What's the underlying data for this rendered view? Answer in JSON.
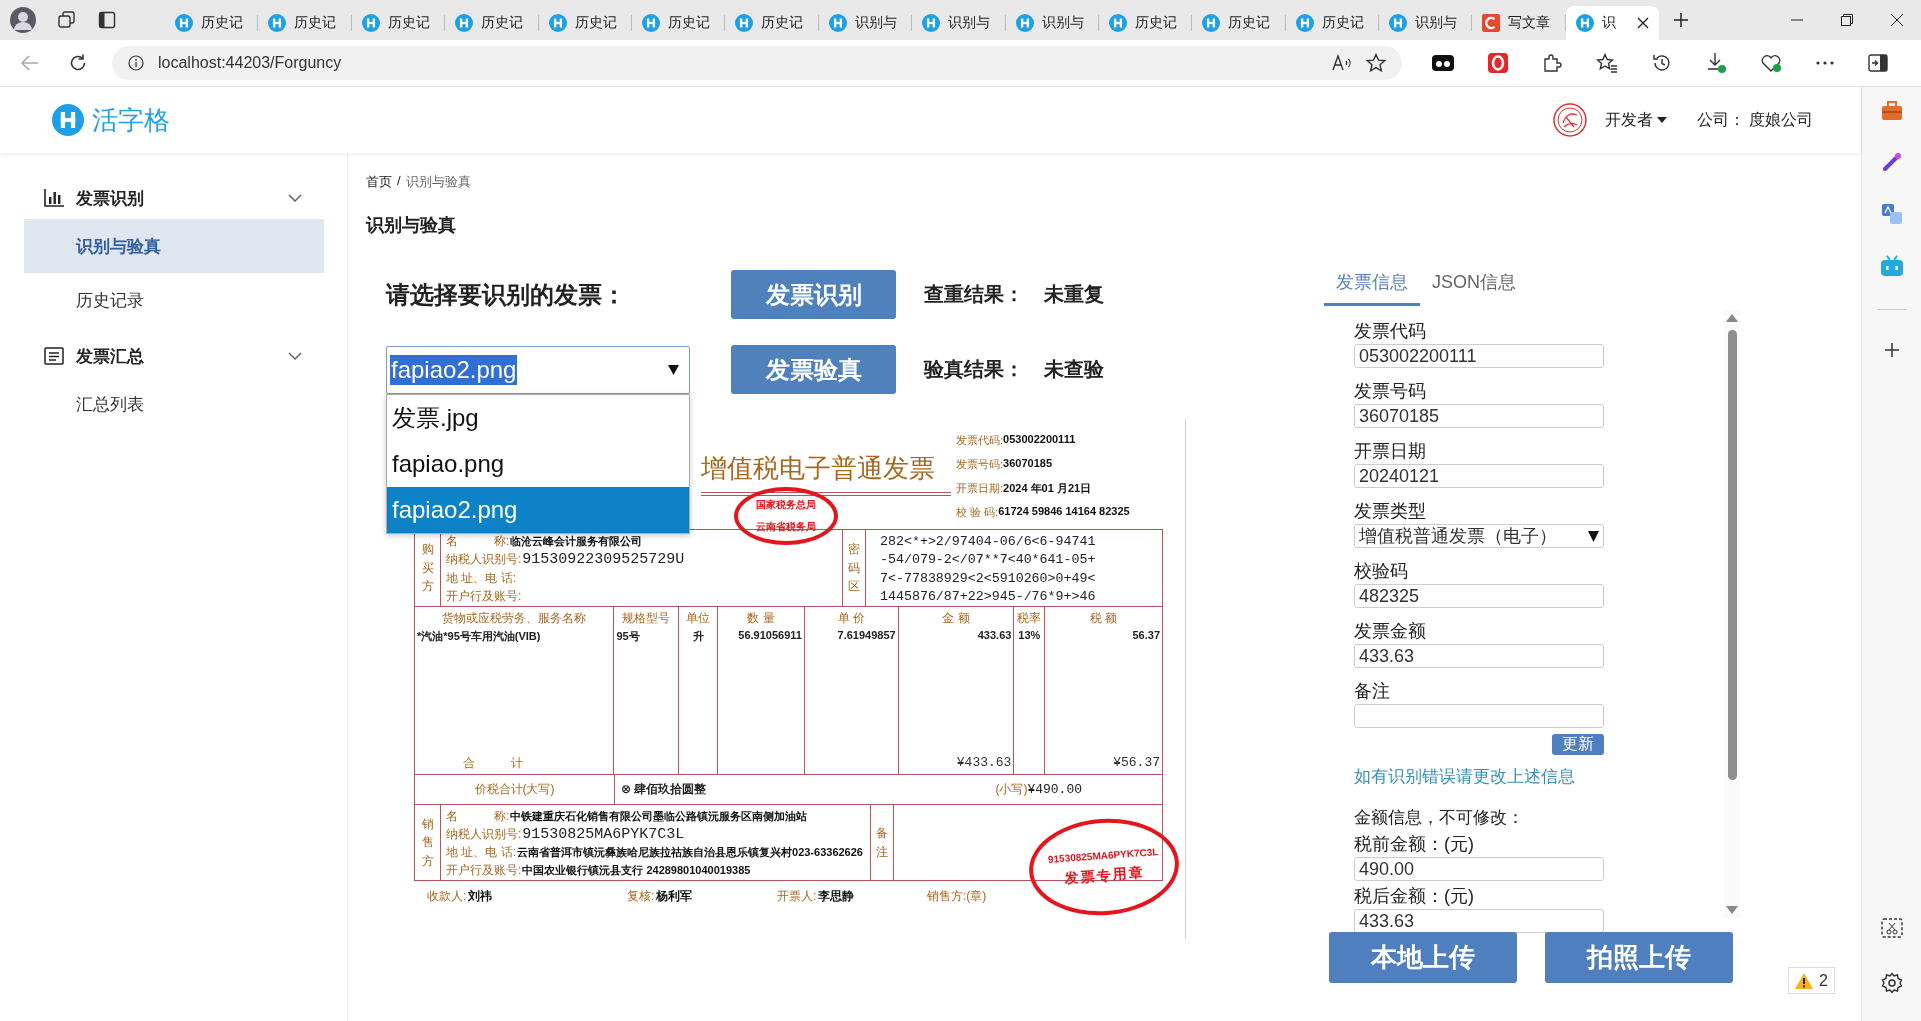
{
  "browser": {
    "tabs": [
      {
        "label": "历史记",
        "kind": "app",
        "selected": false
      },
      {
        "label": "历史记",
        "kind": "app",
        "selected": false
      },
      {
        "label": "历史记",
        "kind": "app",
        "selected": false
      },
      {
        "label": "历史记",
        "kind": "app",
        "selected": false
      },
      {
        "label": "历史记",
        "kind": "app",
        "selected": false
      },
      {
        "label": "历史记",
        "kind": "app",
        "selected": false
      },
      {
        "label": "历史记",
        "kind": "app",
        "selected": false
      },
      {
        "label": "识别与",
        "kind": "app",
        "selected": false
      },
      {
        "label": "识别与",
        "kind": "app",
        "selected": false
      },
      {
        "label": "识别与",
        "kind": "app",
        "selected": false
      },
      {
        "label": "历史记",
        "kind": "app",
        "selected": false
      },
      {
        "label": "历史记",
        "kind": "app",
        "selected": false
      },
      {
        "label": "历史记",
        "kind": "app",
        "selected": false
      },
      {
        "label": "识别与",
        "kind": "app",
        "selected": false
      },
      {
        "label": "写文章",
        "kind": "blog",
        "selected": false
      },
      {
        "label": "识",
        "kind": "app",
        "selected": true
      }
    ],
    "address": "localhost:44203/Forguncy"
  },
  "app_header": {
    "logo": "活字格",
    "user": "开发者",
    "company_label": "公司：",
    "company": "度娘公司"
  },
  "sidebar": {
    "items": [
      {
        "label": "发票识别",
        "kind": "chart",
        "expanded": true,
        "children": [
          {
            "label": "识别与验真",
            "selected": true
          },
          {
            "label": "历史记录",
            "selected": false
          }
        ]
      },
      {
        "label": "发票汇总",
        "kind": "list",
        "expanded": true,
        "children": [
          {
            "label": "汇总列表",
            "selected": false
          }
        ]
      }
    ]
  },
  "breadcrumb": {
    "items": [
      "首页",
      "识别与验真"
    ],
    "separator": "/"
  },
  "page_title": "识别与验真",
  "select_prompt": "请选择要识别的发票：",
  "file_select": {
    "value": "fapiao2.png",
    "expanded": true,
    "options": [
      {
        "label": "发票.jpg",
        "selected": false
      },
      {
        "label": "fapiao.png",
        "selected": false
      },
      {
        "label": "fapiao2.png",
        "selected": true
      }
    ]
  },
  "actions": [
    {
      "button": "发票识别",
      "result_label": "查重结果：",
      "result": "未重复"
    },
    {
      "button": "发票验真",
      "result_label": "验真结果：",
      "result": "未查验"
    }
  ],
  "invoice": {
    "title": "增值税电子普通发票",
    "seal_top": [
      "国家税务总局",
      "云南省税务局"
    ],
    "meta": [
      {
        "label": "发票代码:",
        "value": "053002200111"
      },
      {
        "label": "发票号码:",
        "value": "36070185"
      },
      {
        "label": "开票日期:",
        "value": "2024 年01 月21日"
      },
      {
        "label": "校 验 码:",
        "value": "61724 59846 14164 82325"
      }
    ],
    "buyer": {
      "side": "购买方",
      "fields": [
        {
          "label": "名　　　称:",
          "value": "临沧云峰会计服务有限公司"
        },
        {
          "label": "纳税人识别号:",
          "value": "91530922309525729U"
        },
        {
          "label": "地 址、电 话:"
        },
        {
          "label": "开户行及账号:"
        }
      ],
      "cipher_label": "密码区",
      "cipher": [
        "282<*+>2/97404-06/6<6-94741",
        "-54/079-2</07**7<40*641-05+",
        "7<-77838929<2<5910260>0+49<",
        "1445876/87+22>945-/76*9+>46"
      ]
    },
    "columns": [
      "货物或应税劳务、服务名称",
      "规格型号",
      "单位",
      "数 量",
      "单 价",
      "金 额",
      "税率",
      "税 额"
    ],
    "rows": [
      [
        "*汽油*95号车用汽油(VIB)",
        "95号",
        "升",
        "56.91056911",
        "7.61949857",
        "433.63",
        "13%",
        "56.37"
      ]
    ],
    "total": {
      "label": "合　　　计",
      "amount": "¥433.63",
      "tax": "¥56.37"
    },
    "grand": {
      "label": "价税合计(大写)",
      "words": "⊗ 肆佰玖拾圆整",
      "small_label": "(小写)",
      "small_value": "¥490.00"
    },
    "seller": {
      "side": "销售方",
      "fields": [
        {
          "label": "名　　　称:",
          "value": "中铁建重庆石化销售有限公司墨临公路镇沅服务区南侧加油站"
        },
        {
          "label": "纳税人识别号:",
          "value": "91530825MA6PYK7C3L"
        },
        {
          "label": "地 址、电 话:",
          "value": "云南省普洱市镇沅彝族哈尼族拉祜族自治县恩乐镇复兴村023-63362626"
        },
        {
          "label": "开户行及账号:",
          "value": "中国农业银行镇沅县支行 24289801040019385"
        }
      ],
      "remark_label": "备注"
    },
    "signatures": [
      {
        "label": "收款人:",
        "value": "刘祎"
      },
      {
        "label": "复核:",
        "value": "杨利军"
      },
      {
        "label": "开票人:",
        "value": "李思静"
      },
      {
        "label": "销售方:(章)"
      }
    ],
    "seal_bottom": [
      "91530825MA6PYK7C3L",
      "发票专用章"
    ]
  },
  "info_tabs": [
    {
      "label": "发票信息",
      "selected": true
    },
    {
      "label": "JSON信息",
      "selected": false
    }
  ],
  "info_fields": [
    {
      "label": "发票代码",
      "kind": "input",
      "value": "053002200111"
    },
    {
      "label": "发票号码",
      "kind": "input",
      "value": "36070185"
    },
    {
      "label": "开票日期",
      "kind": "input",
      "value": "20240121"
    },
    {
      "label": "发票类型",
      "kind": "select",
      "value": "增值税普通发票（电子）"
    },
    {
      "label": "校验码",
      "kind": "input",
      "value": "482325"
    },
    {
      "label": "发票金额",
      "kind": "input",
      "value": "433.63"
    },
    {
      "label": "备注",
      "kind": "input"
    }
  ],
  "update_button": "更新",
  "hint_link": "如有识别错误请更改上述信息",
  "amount_note": "金额信息，不可修改：",
  "amount_fields": [
    {
      "label": "税前金额：(元)",
      "value": "490.00"
    },
    {
      "label": "税后金额：(元)",
      "value": "433.63"
    }
  ],
  "upload_buttons": [
    "本地上传",
    "拍照上传"
  ],
  "warning_badge": {
    "count": "2"
  }
}
